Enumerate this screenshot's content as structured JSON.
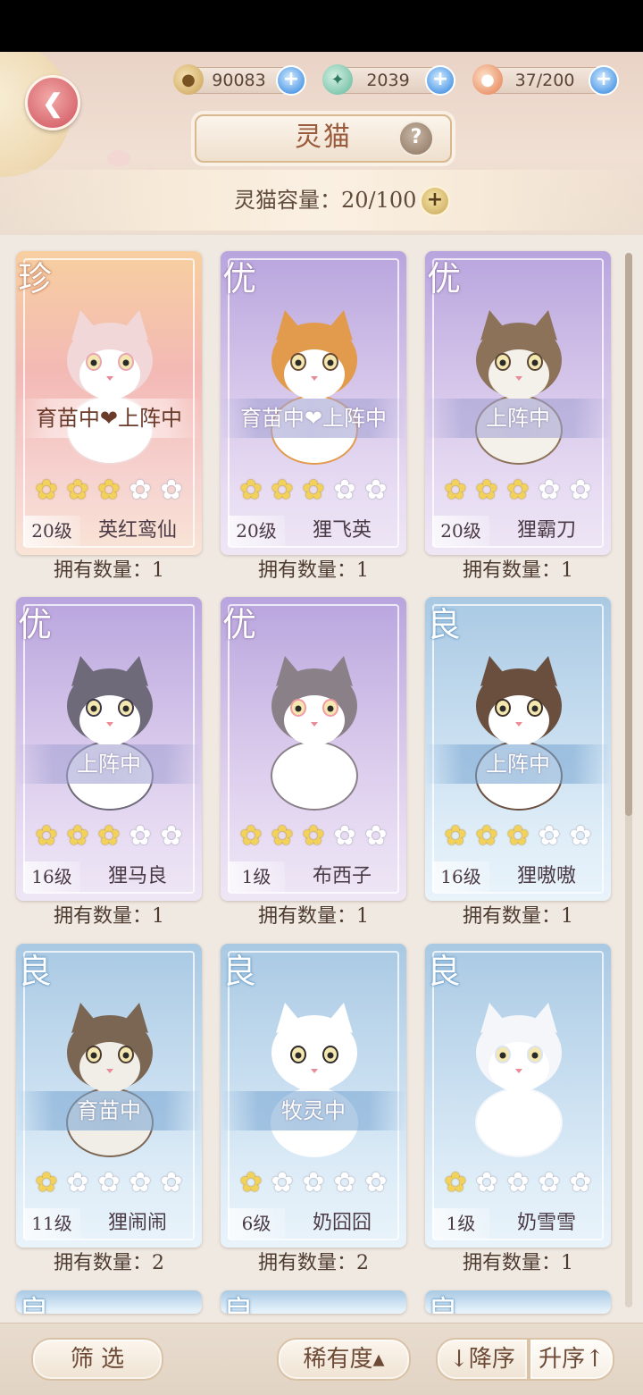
{
  "resources": [
    {
      "icon": "paw-coin-icon",
      "value": "90083"
    },
    {
      "icon": "fish-icon",
      "value": "2039"
    },
    {
      "icon": "food-bowl-icon",
      "value": "37/200"
    }
  ],
  "title": "灵猫",
  "capacity": "灵猫容量：20/100",
  "cards": [
    {
      "grade": "珍",
      "rarity": "rare",
      "status": "育苗中❤上阵中",
      "stars": 3,
      "level": "20级",
      "name": "英红鸾仙",
      "count": "拥有数量：1"
    },
    {
      "grade": "优",
      "rarity": "good",
      "status": "育苗中❤上阵中",
      "stars": 3,
      "level": "20级",
      "name": "狸飞英",
      "count": "拥有数量：1"
    },
    {
      "grade": "优",
      "rarity": "good",
      "status": "上阵中",
      "stars": 3,
      "level": "20级",
      "name": "狸霸刀",
      "count": "拥有数量：1"
    },
    {
      "grade": "优",
      "rarity": "good",
      "status": "上阵中",
      "stars": 3,
      "level": "16级",
      "name": "狸马良",
      "count": "拥有数量：1"
    },
    {
      "grade": "优",
      "rarity": "good",
      "status": "",
      "stars": 3,
      "level": "1级",
      "name": "布西子",
      "count": "拥有数量：1"
    },
    {
      "grade": "良",
      "rarity": "fine",
      "status": "上阵中",
      "stars": 3,
      "level": "16级",
      "name": "狸嗷嗷",
      "count": "拥有数量：1"
    },
    {
      "grade": "良",
      "rarity": "fine",
      "status": "育苗中",
      "stars": 1,
      "level": "11级",
      "name": "狸闹闹",
      "count": "拥有数量：2"
    },
    {
      "grade": "良",
      "rarity": "fine",
      "status": "牧灵中",
      "stars": 1,
      "level": "6级",
      "name": "奶囧囧",
      "count": "拥有数量：2"
    },
    {
      "grade": "良",
      "rarity": "fine",
      "status": "",
      "stars": 1,
      "level": "1级",
      "name": "奶雪雪",
      "count": "拥有数量：1"
    }
  ],
  "partial_grades": [
    "良",
    "良",
    "良"
  ],
  "bottom": {
    "filter": "筛 选",
    "rarity": "稀有度▴",
    "desc": "↓降序",
    "asc": "升序↑"
  },
  "colors": {
    "rare": "#f3b9b5",
    "good": "#c9b6e6",
    "fine": "#bcd6ec",
    "star_on": "#f2d25b"
  }
}
